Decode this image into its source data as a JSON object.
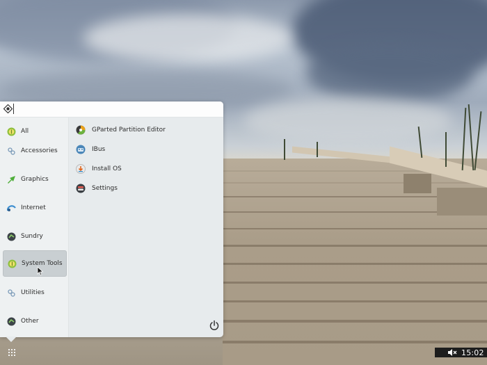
{
  "launcher": {
    "search": {
      "value": "",
      "placeholder": ""
    },
    "categories": [
      {
        "label": "All",
        "icon": "all-icon",
        "active": false
      },
      {
        "label": "Accessories",
        "icon": "accessories-icon",
        "active": false
      },
      {
        "label": "Graphics",
        "icon": "graphics-icon",
        "active": false
      },
      {
        "label": "Internet",
        "icon": "internet-icon",
        "active": false
      },
      {
        "label": "Sundry",
        "icon": "sundry-icon",
        "active": false
      },
      {
        "label": "System Tools",
        "icon": "system-tools-icon",
        "active": true
      },
      {
        "label": "Utilities",
        "icon": "utilities-icon",
        "active": false
      },
      {
        "label": "Other",
        "icon": "other-icon",
        "active": false
      }
    ],
    "apps": [
      {
        "label": "GParted Partition Editor",
        "icon": "gparted-icon"
      },
      {
        "label": "IBus",
        "icon": "ibus-icon"
      },
      {
        "label": "Install OS",
        "icon": "install-os-icon"
      },
      {
        "label": "Settings",
        "icon": "settings-icon"
      }
    ],
    "power_icon": "power-icon"
  },
  "panel": {
    "menu_icon": "app-grid-icon",
    "volume_icon": "volume-muted-icon",
    "clock": "15:02"
  },
  "colors": {
    "launcher_bg": "#e7ebed",
    "active_category": "#c9cfd2",
    "tray_bg": "#1d1d1d"
  }
}
